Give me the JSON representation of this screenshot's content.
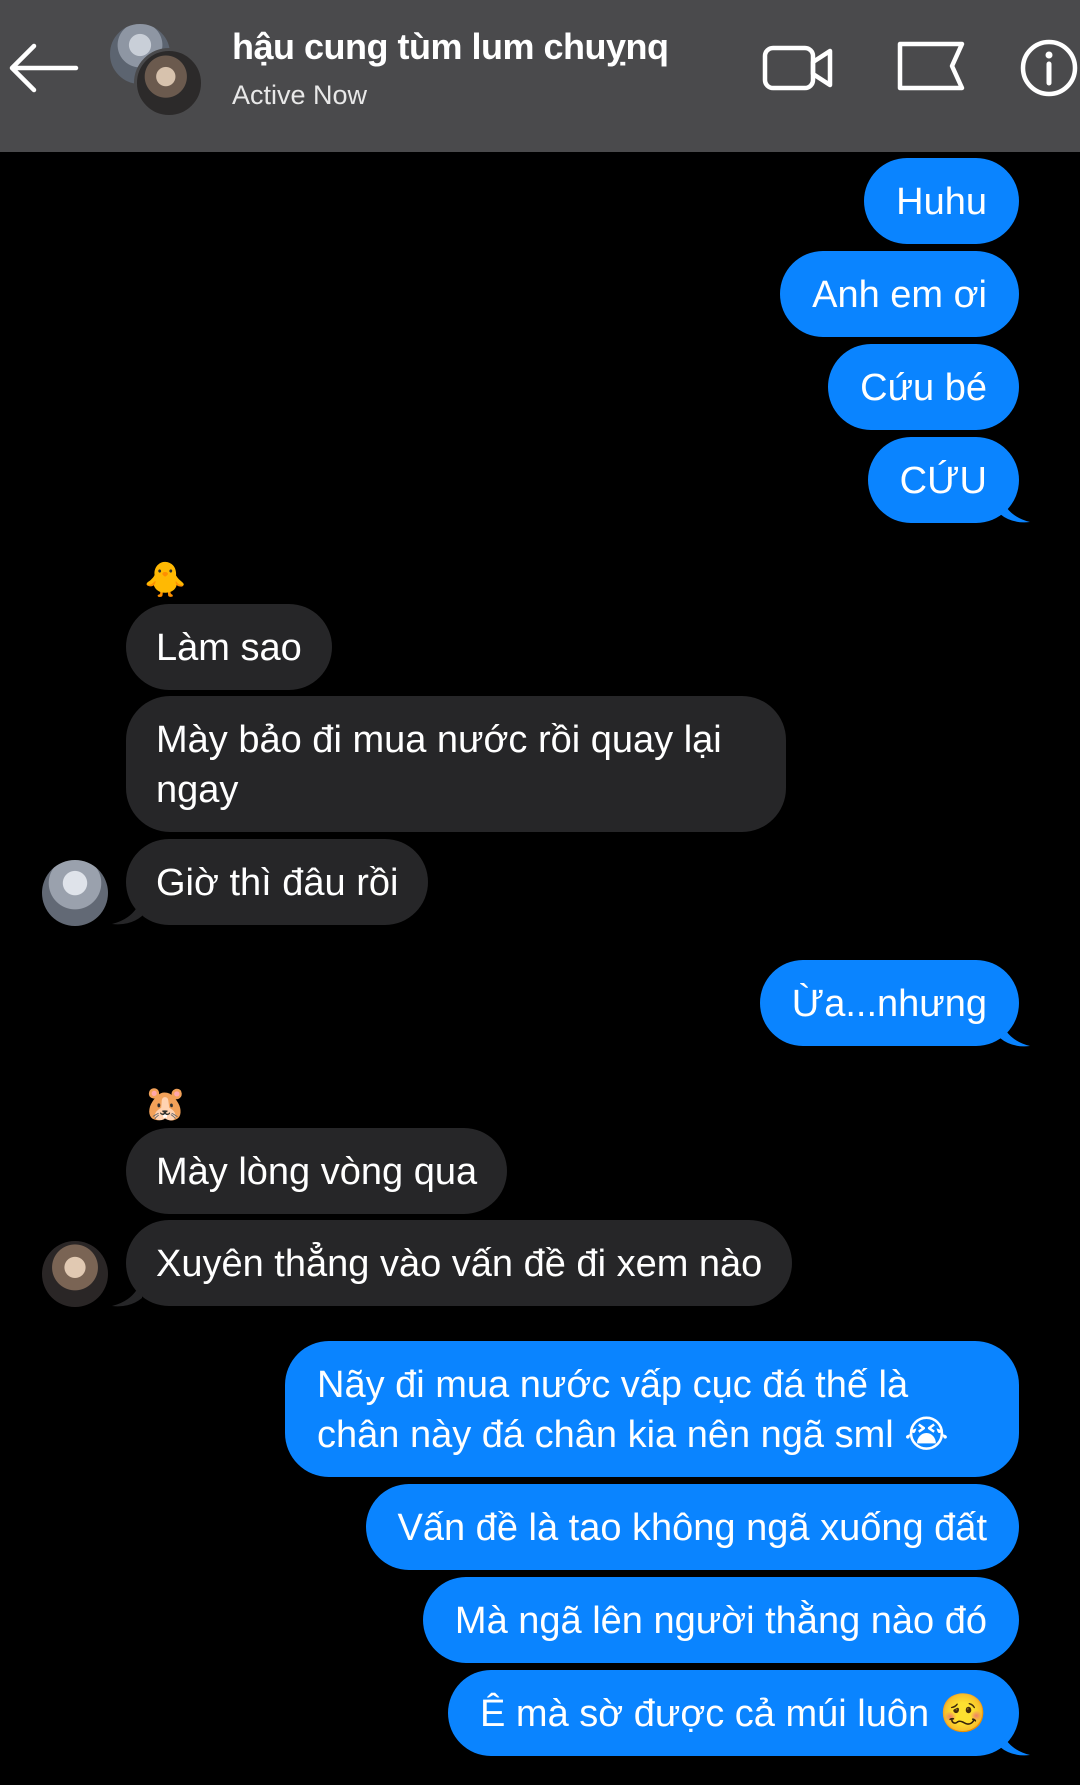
{
  "header": {
    "title": "hậu cung tùm lum chuỵnq",
    "status": "Active Now",
    "icons": [
      "arrow-left-icon",
      "video-camera-icon",
      "flag-icon",
      "info-icon"
    ]
  },
  "messages": {
    "m1": "Huhu",
    "m2": "Anh em ơi",
    "m3": "Cứu bé",
    "m4": "CỨU",
    "m5": "Làm sao",
    "m6_line1": "Mày bảo đi mua nước rồi quay lại",
    "m6_line2": "ngay",
    "m7": "Giờ thì đâu rồi",
    "m8": "Ừa...nhưng",
    "m9": "Mày lòng vòng qua",
    "m10": "Xuyên thẳng vào vấn đề đi xem nào",
    "m11_line1": "Nãy đi mua nước vấp cục đá thế là",
    "m11_line2": "chân này đá chân kia nên ngã sml 😭",
    "m12": "Vấn đề là tao không ngã xuống đất",
    "m13": "Mà ngã lên người thằng nào đó",
    "m14": "Ê mà sờ được cả múi luôn 🥴"
  },
  "reactions": {
    "chick": "🐥",
    "hamster": "🐹"
  },
  "colors": {
    "header_bg": "#4a4a4c",
    "sent_bubble": "#0a84ff",
    "received_bubble": "#262628",
    "background": "#000000"
  }
}
